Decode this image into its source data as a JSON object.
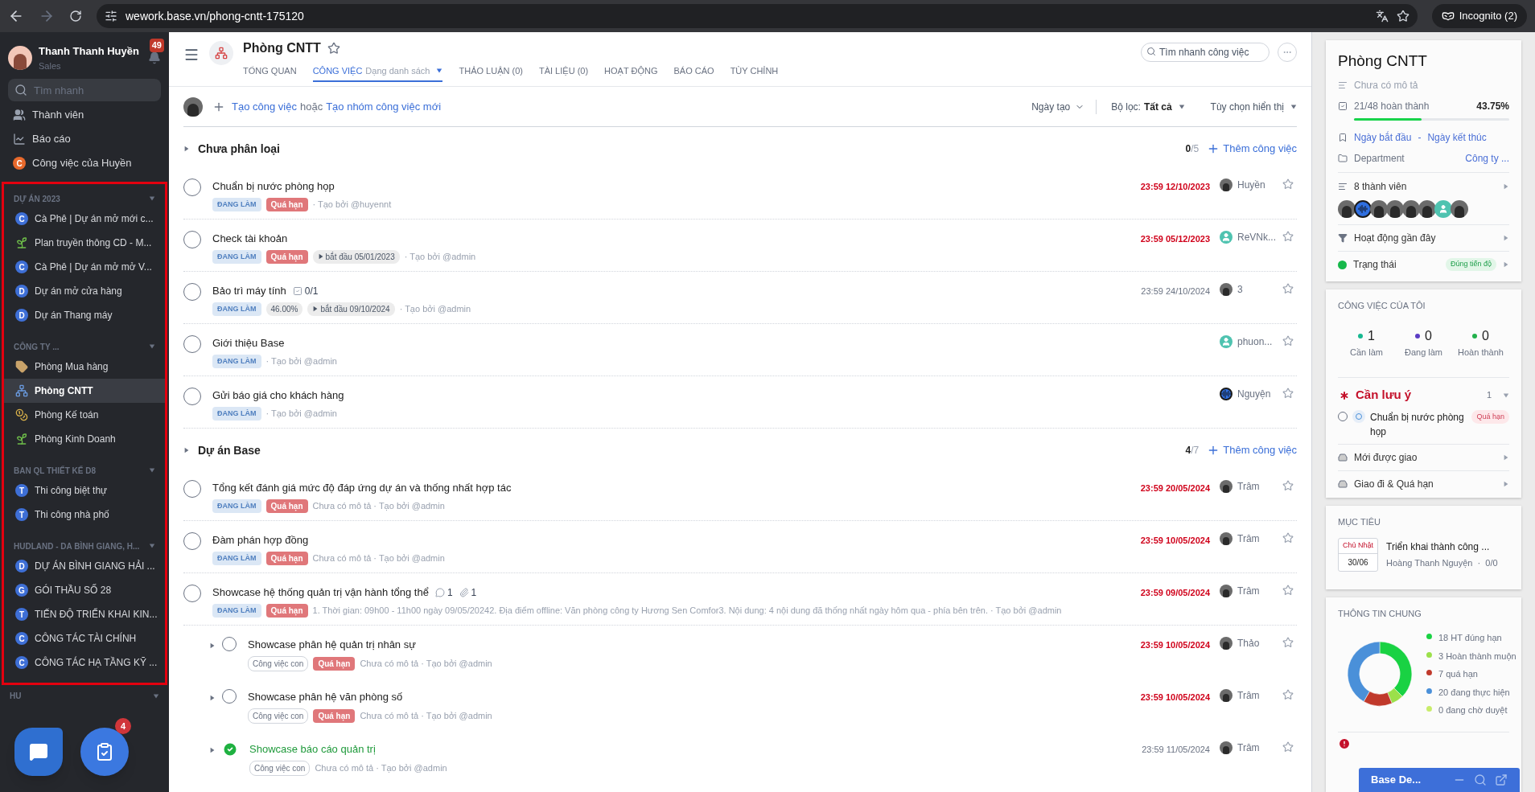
{
  "browser": {
    "url": "wework.base.vn/phong-cntt-175120",
    "incognito": "Incognito (2)"
  },
  "sidebar": {
    "user": {
      "name": "Thanh Thanh Huyền",
      "role": "Sales",
      "notifications": "49"
    },
    "search": {
      "placeholder": "Tìm nhanh"
    },
    "nav": [
      {
        "kind": "users",
        "label": "Thành viên"
      },
      {
        "kind": "chart",
        "label": "Báo cáo"
      },
      {
        "kind": "letter",
        "letter": "C",
        "color": "#e8692c",
        "label": "Công việc của Huyền"
      }
    ],
    "groups": [
      {
        "title": "DỰ ÁN 2023",
        "items": [
          {
            "kind": "letter",
            "letter": "C",
            "color": "#3e6fd6",
            "label": "Cà Phê | Dự án mở mới c...",
            "selected": false
          },
          {
            "kind": "sprout",
            "label": "Plan truyền thông CD - M...",
            "selected": false
          },
          {
            "kind": "letter",
            "letter": "C",
            "color": "#3e6fd6",
            "label": "Cà Phê | Dự án mở mở V...",
            "selected": false
          },
          {
            "kind": "letter",
            "letter": "D",
            "color": "#3e6fd6",
            "label": "Dự án mở cửa hàng",
            "selected": false
          },
          {
            "kind": "letter",
            "letter": "D",
            "color": "#3e6fd6",
            "label": "Dự án Thang máy",
            "selected": false
          }
        ]
      },
      {
        "title": "CÔNG TY ...",
        "items": [
          {
            "kind": "tag",
            "label": "Phòng Mua hàng",
            "selected": false
          },
          {
            "kind": "org",
            "label": "Phòng CNTT",
            "selected": true
          },
          {
            "kind": "coins",
            "label": "Phòng Kế toán",
            "selected": false
          },
          {
            "kind": "sprout",
            "label": "Phòng Kinh Doanh",
            "selected": false
          }
        ]
      },
      {
        "title": "BAN QL THIẾT KẾ D8",
        "items": [
          {
            "kind": "letter",
            "letter": "T",
            "color": "#3e6fd6",
            "label": "Thi công biệt thự",
            "selected": false
          },
          {
            "kind": "letter",
            "letter": "T",
            "color": "#3e6fd6",
            "label": "Thi công nhà phố",
            "selected": false
          }
        ]
      },
      {
        "title": "HUDLAND - DA BÌNH GIANG, H...",
        "items": [
          {
            "kind": "letter",
            "letter": "D",
            "color": "#3e6fd6",
            "label": "DỰ ÁN BÌNH GIANG HẢI ...",
            "selected": false
          },
          {
            "kind": "letter",
            "letter": "G",
            "color": "#3e6fd6",
            "label": "GÓI THẦU SỐ 28",
            "selected": false
          },
          {
            "kind": "letter",
            "letter": "T",
            "color": "#3e6fd6",
            "label": "TIẾN ĐỘ TRIỂN KHAI KIN...",
            "selected": false
          },
          {
            "kind": "letter",
            "letter": "C",
            "color": "#3e6fd6",
            "label": "CÔNG TÁC TÀI CHÍNH",
            "selected": false
          },
          {
            "kind": "letter",
            "letter": "C",
            "color": "#3e6fd6",
            "label": "CÔNG TÁC HẠ TẦNG KỸ ...",
            "selected": false
          }
        ]
      }
    ],
    "last_group": "HU",
    "task_badge": "4"
  },
  "header": {
    "title": "Phòng CNTT",
    "tabs": [
      {
        "label": "TỔNG QUAN",
        "selected": false
      },
      {
        "label": "CÔNG VIỆC",
        "sub": "Dạng danh sách",
        "selected": true
      },
      {
        "label": "THẢO LUẬN (0)",
        "selected": false
      },
      {
        "label": "TÀI LIỆU (0)",
        "selected": false
      },
      {
        "label": "HOẠT ĐỘNG",
        "selected": false
      },
      {
        "label": "BÁO CÁO",
        "selected": false
      },
      {
        "label": "TÙY CHỈNH",
        "selected": false
      }
    ],
    "search": {
      "placeholder": "Tìm nhanh công việc"
    }
  },
  "toolbar": {
    "create": "Tạo công việc",
    "or": "hoặc",
    "create_group": "Tạo nhóm công việc mới",
    "sort": "Ngày tạo",
    "filter_label": "Bộ lọc:",
    "filter_value": "Tất cả",
    "display": "Tùy chọn hiển thị"
  },
  "sections": [
    {
      "title": "Chưa phân loại",
      "done": "0",
      "total": "/5",
      "add": "Thêm công việc",
      "tasks": [
        {
          "title": "Chuẩn bị nước phòng họp",
          "done": false,
          "badges": [
            {
              "kind": "status",
              "text": "ĐANG LÀM"
            },
            {
              "kind": "overdue",
              "text": "Quá hạn"
            }
          ],
          "note": "· Tạo bởi @huyennt",
          "due": "23:59 12/10/2023",
          "overdue": true,
          "assignee": {
            "kind": "photo",
            "name": "Huyền"
          }
        },
        {
          "title": "Check tài khoản",
          "done": false,
          "badges": [
            {
              "kind": "status",
              "text": "ĐANG LÀM"
            },
            {
              "kind": "overdue",
              "text": "Quá hạn"
            },
            {
              "kind": "start",
              "text": "bắt đầu 05/01/2023"
            }
          ],
          "note": "· Tạo bởi @admin",
          "due": "23:59 05/12/2023",
          "overdue": true,
          "assignee": {
            "kind": "person",
            "name": "ReVNk..."
          }
        },
        {
          "title": "Bảo trì máy tính",
          "counters": [
            {
              "kind": "checklist",
              "text": "0/1"
            }
          ],
          "done": false,
          "badges": [
            {
              "kind": "status",
              "text": "ĐANG LÀM"
            },
            {
              "kind": "progress",
              "text": "46.00%"
            },
            {
              "kind": "start",
              "text": "bắt đầu 09/10/2024"
            }
          ],
          "note": "· Tạo bởi @admin",
          "due": "23:59 24/10/2024",
          "overdue": false,
          "assignee": {
            "kind": "photo",
            "name": "3"
          }
        },
        {
          "title": "Giới thiệu Base",
          "done": false,
          "badges": [
            {
              "kind": "status",
              "text": "ĐANG LÀM"
            }
          ],
          "note": "· Tạo bởi @admin",
          "assignee": {
            "kind": "person",
            "name": "phuon..."
          }
        },
        {
          "title": "Gửi báo giá cho khách hàng",
          "done": false,
          "badges": [
            {
              "kind": "status",
              "text": "ĐANG LÀM"
            }
          ],
          "note": "· Tạo bởi @admin",
          "assignee": {
            "kind": "wave",
            "name": "Nguyện"
          }
        }
      ]
    },
    {
      "title": "Dự án Base",
      "done": "4",
      "total": "/7",
      "add": "Thêm công việc",
      "tasks": [
        {
          "title": "Tổng kết đánh giá mức độ đáp ứng dự án và thống nhất hợp tác",
          "done": false,
          "badges": [
            {
              "kind": "status",
              "text": "ĐANG LÀM"
            },
            {
              "kind": "overdue",
              "text": "Quá hạn"
            }
          ],
          "note": "Chưa có mô tả · Tạo bởi @admin",
          "due": "23:59 20/05/2024",
          "overdue": true,
          "assignee": {
            "kind": "photo",
            "name": "Trâm"
          }
        },
        {
          "title": "Đàm phán hợp đồng",
          "done": false,
          "badges": [
            {
              "kind": "status",
              "text": "ĐANG LÀM"
            },
            {
              "kind": "overdue",
              "text": "Quá hạn"
            }
          ],
          "note": "Chưa có mô tả · Tạo bởi @admin",
          "due": "23:59 10/05/2024",
          "overdue": true,
          "assignee": {
            "kind": "photo",
            "name": "Trâm"
          }
        },
        {
          "title": "Showcase hệ thống quản trị vận hành tổng thể",
          "counters": [
            {
              "kind": "comment",
              "text": "1"
            },
            {
              "kind": "attachment",
              "text": "1"
            }
          ],
          "done": false,
          "badges": [
            {
              "kind": "status",
              "text": "ĐANG LÀM"
            },
            {
              "kind": "overdue",
              "text": "Quá hạn"
            }
          ],
          "note": "1. Thời gian: 09h00 - 11h00 ngày 09/05/20242. Địa điểm offline: Văn phòng công ty Hương Sen Comfor3. Nội dung: 4 nội dung đã thống nhất ngày hôm qua - phía bên trên. · Tạo bởi @admin",
          "due": "23:59 09/05/2024",
          "overdue": true,
          "assignee": {
            "kind": "photo",
            "name": "Trâm"
          },
          "children": [
            {
              "title": "Showcase phân hệ quản trị nhân sự",
              "done": false,
              "badges": [
                {
                  "kind": "subtask",
                  "text": "Công việc con"
                },
                {
                  "kind": "overdue",
                  "text": "Quá hạn"
                }
              ],
              "note": "Chưa có mô tả · Tạo bởi @admin",
              "due": "23:59 10/05/2024",
              "overdue": true,
              "assignee": {
                "kind": "photo",
                "name": "Thảo"
              }
            },
            {
              "title": "Showcase phân hệ văn phòng số",
              "done": false,
              "badges": [
                {
                  "kind": "subtask",
                  "text": "Công việc con"
                },
                {
                  "kind": "overdue",
                  "text": "Quá hạn"
                }
              ],
              "note": "Chưa có mô tả · Tạo bởi @admin",
              "due": "23:59 10/05/2024",
              "overdue": true,
              "assignee": {
                "kind": "photo",
                "name": "Trâm"
              }
            },
            {
              "title": "Showcase báo cáo quản trị",
              "done": true,
              "badges": [
                {
                  "kind": "subtask",
                  "text": "Công việc con"
                }
              ],
              "note": "Chưa có mô tả · Tạo bởi @admin",
              "due": "23:59 11/05/2024",
              "overdue": false,
              "assignee": {
                "kind": "photo",
                "name": "Trâm"
              }
            }
          ]
        }
      ]
    }
  ],
  "info": {
    "title": "Phòng CNTT",
    "description": "Chưa có mô tả",
    "progress_text": "21/48 hoàn thành",
    "percent": "43.75%",
    "level": 0.4375,
    "start": "Ngày bắt đầu",
    "dash": "-",
    "end": "Ngày kết thúc",
    "department_label": "Department",
    "department": "Công ty ...",
    "members": "8 thành viên",
    "member_avatars": [
      {
        "kind": "photo"
      },
      {
        "kind": "wave"
      },
      {
        "kind": "photo"
      },
      {
        "kind": "photo"
      },
      {
        "kind": "photo"
      },
      {
        "kind": "photo"
      },
      {
        "kind": "person"
      },
      {
        "kind": "photo"
      }
    ],
    "activity": "Hoạt động gần đây",
    "status_label": "Trạng thái",
    "status": "Đúng tiến độ"
  },
  "my_tasks": {
    "title": "CÔNG VIỆC CỦA TÔI",
    "stats": [
      {
        "value": "1",
        "label": "Cần làm",
        "color": "#17b890"
      },
      {
        "value": "0",
        "label": "Đang làm",
        "color": "#5b3cc4"
      },
      {
        "value": "0",
        "label": "Hoàn thành",
        "color": "#22b14c"
      }
    ],
    "attention": {
      "title": "Cần lưu ý",
      "count": "1",
      "items": [
        {
          "title": "Chuẩn bị nước phòng họp",
          "tag": "Quá hạn",
          "done": false
        }
      ]
    },
    "links": [
      "Mới được giao",
      "Giao đi & Quá hạn"
    ]
  },
  "goals": {
    "title": "MỤC TIÊU",
    "day": "Chủ Nhật",
    "date": "30/06",
    "name": "Triển khai thành công ...",
    "meta": "Hoàng Thanh Nguyện  ·  0/0"
  },
  "general": {
    "title": "THÔNG TIN CHUNG",
    "legend": [
      {
        "color": "#19d243"
      },
      {
        "color": "#9be04a"
      },
      {
        "color": "#c0392b"
      },
      {
        "color": "#4a90d9"
      },
      {
        "color": "#c8ec6a"
      }
    ],
    "chart_data": {
      "type": "donut",
      "categories": [
        "18 HT đúng hạn",
        "3 Hoàn thành muộn",
        "7 quá hạn",
        "20 đang thực hiện",
        "0 đang chờ duyệt"
      ],
      "series": [
        {
          "values": [
            18,
            3,
            7,
            20,
            0
          ]
        }
      ]
    }
  },
  "chat": {
    "title": "Base De..."
  }
}
